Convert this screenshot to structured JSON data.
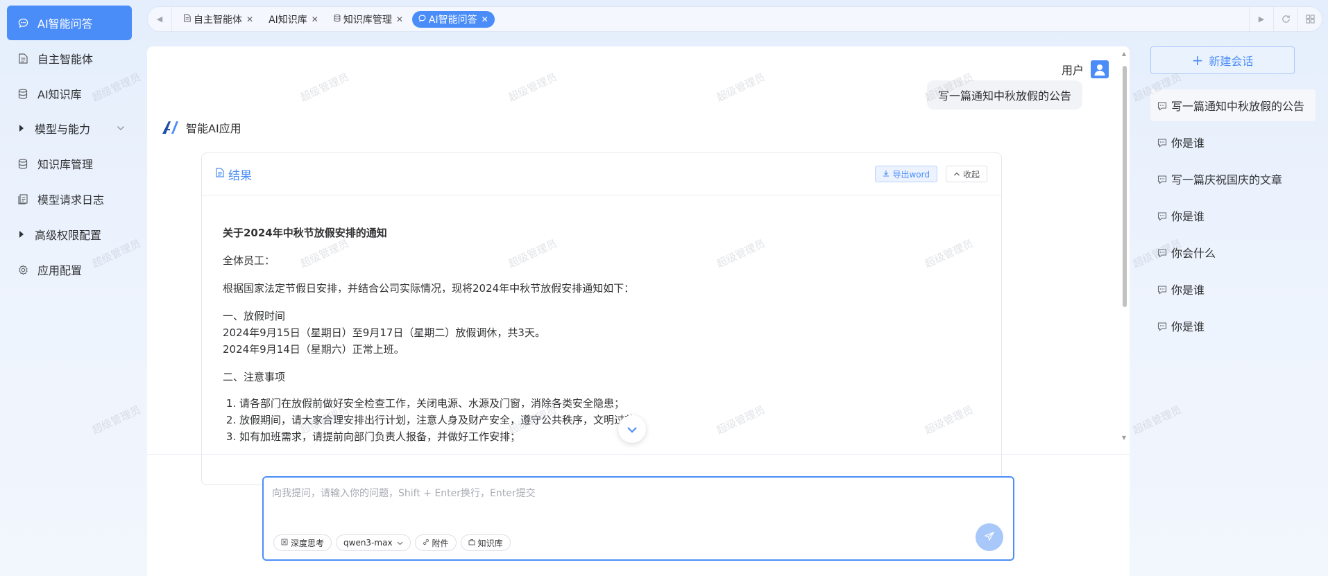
{
  "sidebar": {
    "items": [
      {
        "label": "AI智能问答",
        "icon": "chat-icon",
        "active": true
      },
      {
        "label": "自主智能体",
        "icon": "document-icon"
      },
      {
        "label": "AI知识库",
        "icon": "database-icon"
      },
      {
        "label": "模型与能力",
        "icon": "caret-right-icon",
        "expandable": true
      },
      {
        "label": "知识库管理",
        "icon": "database-icon"
      },
      {
        "label": "模型请求日志",
        "icon": "log-icon"
      },
      {
        "label": "高级权限配置",
        "icon": "caret-right-icon"
      },
      {
        "label": "应用配置",
        "icon": "gear-icon"
      }
    ]
  },
  "tabs": [
    {
      "label": "自主智能体",
      "icon": "document-icon"
    },
    {
      "label": "AI知识库",
      "icon": ""
    },
    {
      "label": "知识库管理",
      "icon": "database-icon"
    },
    {
      "label": "AI智能问答",
      "icon": "chat-icon",
      "active": true
    }
  ],
  "chat": {
    "user_name": "用户",
    "user_message": "写一篇通知中秋放假的公告",
    "ai_name": "智能AI应用",
    "result_title": "结果",
    "export_label": "导出word",
    "fold_label": "收起",
    "doc_title": "关于2024年中秋节放假安排的通知",
    "greeting": "全体员工：",
    "intro": "根据国家法定节假日安排，并结合公司实际情况，现将2024年中秋节放假安排通知如下：",
    "section1_title": "一、放假时间",
    "section1_line1": "2024年9月15日（星期日）至9月17日（星期二）放假调休，共3天。",
    "section1_line2": "2024年9月14日（星期六）正常上班。",
    "section2_title": "二、注意事项",
    "notes": [
      "请各部门在放假前做好安全检查工作，关闭电源、水源及门窗，消除各类安全隐患；",
      "放假期间，请大家合理安排出行计划，注意人身及财产安全，遵守公共秩序，文明过节；",
      "如有加班需求，请提前向部门负责人报备，并做好工作安排；"
    ]
  },
  "input": {
    "placeholder": "向我提问，请输入你的问题，Shift + Enter换行，Enter提交",
    "chips": {
      "deep_think": "深度思考",
      "model": "qwen3-max",
      "attachment": "附件",
      "knowledge": "知识库"
    }
  },
  "history": {
    "new_chat": "新建会话",
    "items": [
      {
        "label": "写一篇通知中秋放假的公告",
        "active": true
      },
      {
        "label": "你是谁"
      },
      {
        "label": "写一篇庆祝国庆的文章"
      },
      {
        "label": "你是谁"
      },
      {
        "label": "你会什么"
      },
      {
        "label": "你是谁"
      },
      {
        "label": "你是谁"
      }
    ]
  },
  "watermark": "超级管理员",
  "colors": {
    "accent": "#4b8df8",
    "background": "#e4eefc"
  }
}
